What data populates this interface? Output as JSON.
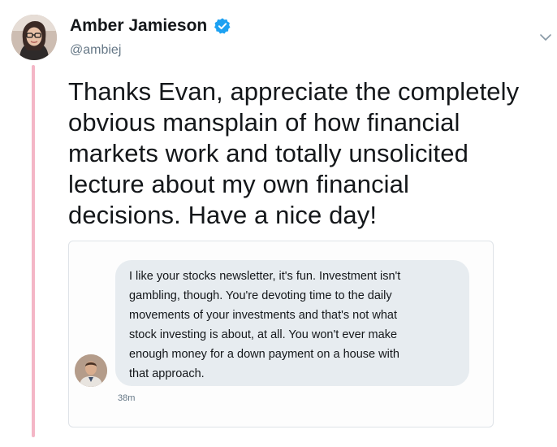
{
  "tweet": {
    "author_name": "Amber Jamieson",
    "handle": "@ambiej",
    "verified_icon": "verified-badge-icon",
    "menu_icon": "chevron-down-icon",
    "text_lines": [
      "Thanks Evan, appreciate the completely",
      "obvious mansplain of how financial",
      "markets work and totally unsolicited",
      "lecture about my own financial",
      "decisions. Have a nice day!"
    ]
  },
  "quoted_message": {
    "lines": [
      "I like your stocks newsletter, it's fun. Investment isn't",
      "gambling, though.  You're devoting time to the daily",
      "movements of your investments and that's not what",
      "stock investing is about, at all. You won't ever make",
      "enough money for a down payment on a house with",
      "that approach."
    ],
    "timestamp": "38m"
  },
  "colors": {
    "thread_line": "#f4b6c6",
    "verified_badge": "#1da1f2",
    "bubble_bg": "#e7ecf0",
    "secondary_text": "#657786"
  }
}
